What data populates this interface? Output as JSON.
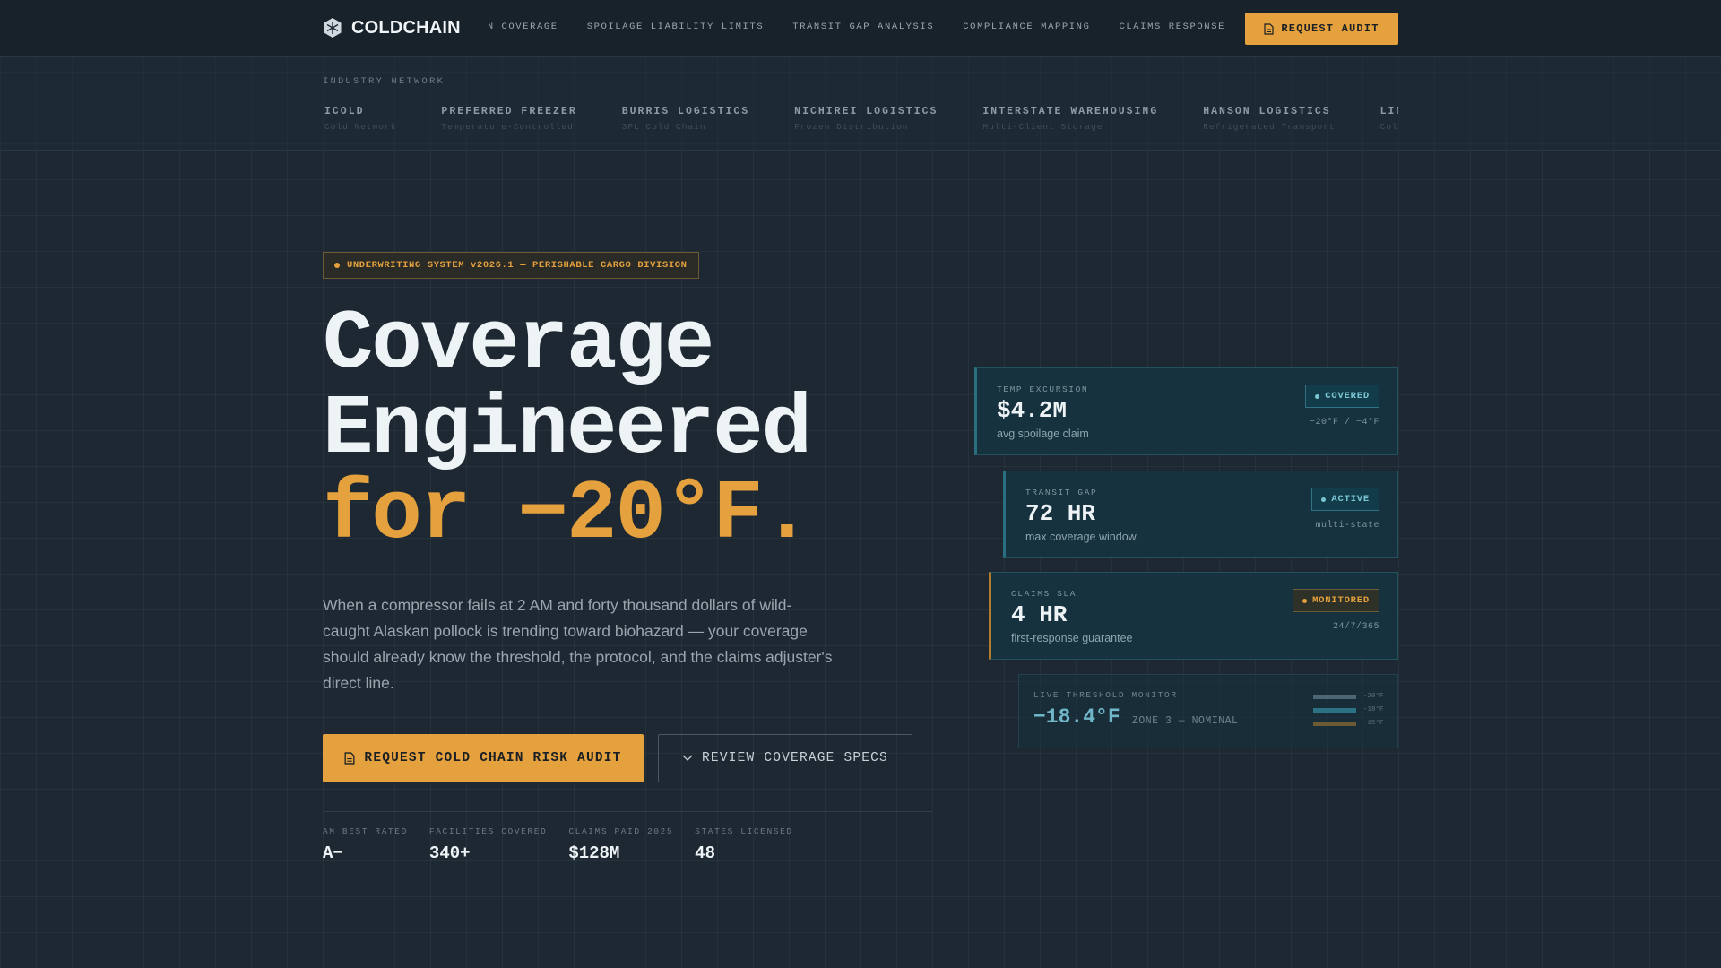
{
  "nav": {
    "brand": "COLDCHAIN",
    "logo_icon": "snowflake-hex-icon",
    "links": [
      {
        "label": "TEMPERATURE EXCURSION COVERAGE"
      },
      {
        "label": "SPOILAGE LIABILITY LIMITS"
      },
      {
        "label": "TRANSIT GAP ANALYSIS"
      },
      {
        "label": "COMPLIANCE MAPPING"
      },
      {
        "label": "CLAIMS RESPONSE"
      }
    ],
    "cta": "REQUEST AUDIT",
    "cta_icon": "document-icon"
  },
  "network": {
    "label": "INDUSTRY NETWORK",
    "partners": [
      {
        "name": "ICOLD",
        "sub": "Cold Network"
      },
      {
        "name": "PREFERRED FREEZER",
        "sub": "Temperature-Controlled"
      },
      {
        "name": "BURRIS LOGISTICS",
        "sub": "3PL Cold Chain"
      },
      {
        "name": "NICHIREI LOGISTICS",
        "sub": "Frozen Distribution"
      },
      {
        "name": "INTERSTATE WAREHOUSING",
        "sub": "Multi-Client Storage"
      },
      {
        "name": "HANSON LOGISTICS",
        "sub": "Refrigerated Transport"
      },
      {
        "name": "LINEAGE",
        "sub": "Cold Storage"
      }
    ]
  },
  "hero": {
    "badge": "UNDERWRITING SYSTEM v2026.1 — PERISHABLE CARGO DIVISION",
    "headline_1": "Coverage",
    "headline_2": "Engineered",
    "headline_3": "for −20°F.",
    "lede": "When a compressor fails at 2 AM and forty thousand dollars of wild-caught Alaskan pollock is trending toward biohazard — your coverage should already know the threshold, the protocol, and the claims adjuster's direct line.",
    "primary_cta": "REQUEST COLD CHAIN RISK AUDIT",
    "primary_icon": "document-icon",
    "secondary_cta": "REVIEW COVERAGE SPECS",
    "secondary_icon": "chevron-down-icon"
  },
  "stats": [
    {
      "label": "AM BEST RATED",
      "value": "A−"
    },
    {
      "label": "FACILITIES COVERED",
      "value": "340+"
    },
    {
      "label": "CLAIMS PAID 2025",
      "value": "$128M"
    },
    {
      "label": "STATES LICENSED",
      "value": "48"
    }
  ],
  "cards": [
    {
      "label": "TEMP EXCURSION",
      "value": "$4.2M",
      "desc": "avg spoilage claim",
      "status": "COVERED",
      "meta": "−20°F / −4°F"
    },
    {
      "label": "TRANSIT GAP",
      "value": "72 HR",
      "desc": "max coverage window",
      "status": "ACTIVE",
      "meta": "multi-state"
    },
    {
      "label": "CLAIMS SLA",
      "value": "4 HR",
      "desc": "first-response guarantee",
      "status": "MONITORED",
      "meta": "24/7/365"
    }
  ],
  "monitor": {
    "label": "LIVE THRESHOLD MONITOR",
    "value": "−18.4°F",
    "zone": "ZONE 3 — NOMINAL",
    "bars": [
      {
        "tick": "-20°F",
        "level": 1.0,
        "color": "#4d6673"
      },
      {
        "tick": "-18°F",
        "level": 1.0,
        "color": "#2b7284"
      },
      {
        "tick": "-15°F",
        "level": 1.0,
        "color": "#6b5a34"
      }
    ]
  },
  "colors": {
    "accent": "#e4a13d",
    "background": "#1d2832",
    "teal": "#7cc6d4"
  }
}
